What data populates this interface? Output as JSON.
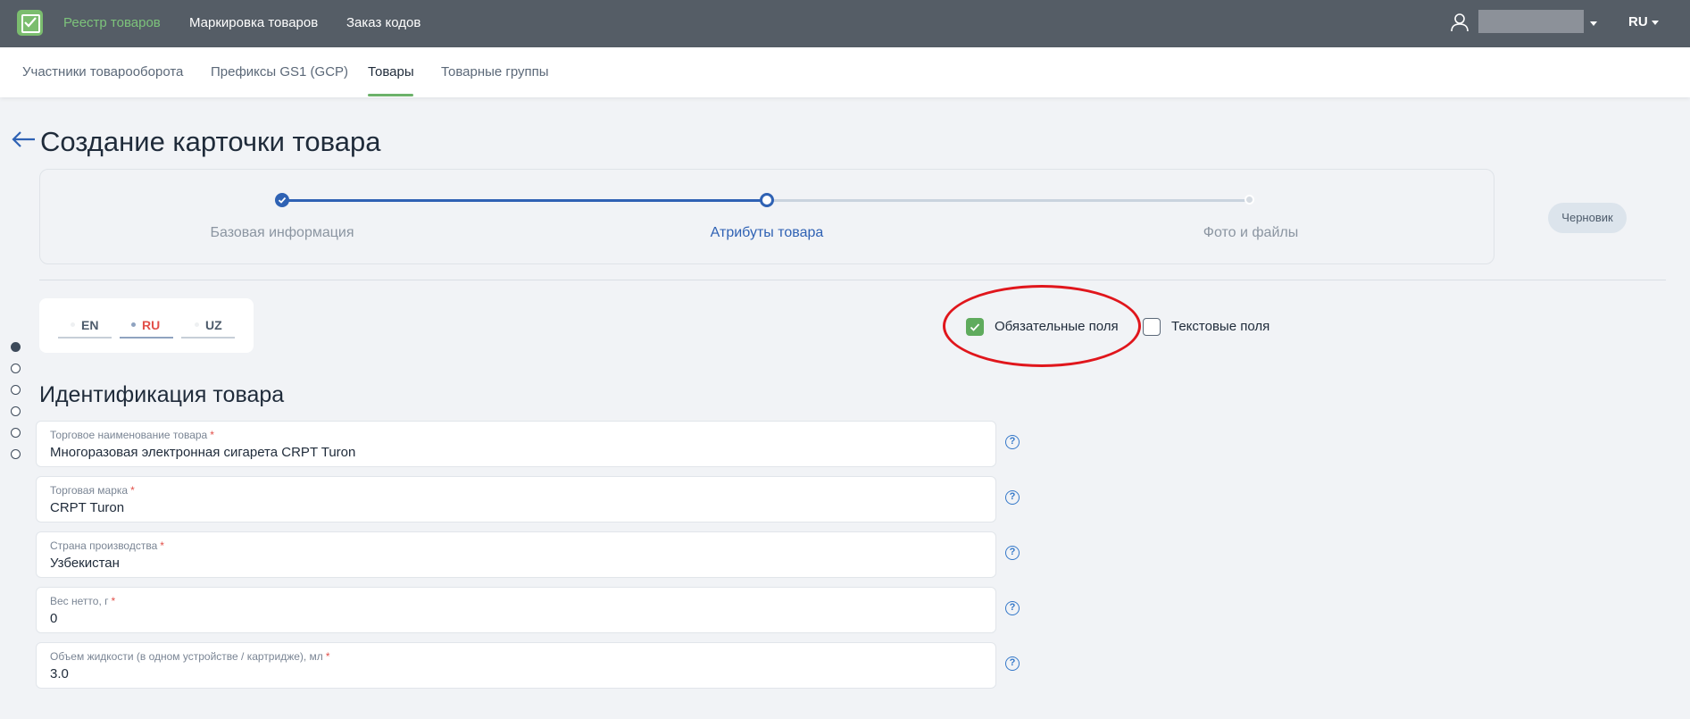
{
  "topbar": {
    "nav": [
      "Реестр товаров",
      "Маркировка товаров",
      "Заказ кодов"
    ],
    "lang": "RU"
  },
  "subnav": {
    "tabs": [
      "Участники товарооборота",
      "Префиксы GS1 (GCP)",
      "Товары",
      "Товарные группы"
    ],
    "active_tab": "Товары"
  },
  "page": {
    "title": "Создание карточки товара"
  },
  "stepper": {
    "steps": [
      "Базовая информация",
      "Атрибуты товара",
      "Фото и файлы"
    ],
    "status_badge": "Черновик"
  },
  "lang_tabs": [
    "EN",
    "RU",
    "UZ"
  ],
  "filters": {
    "required_label": "Обязательные поля",
    "required_checked": true,
    "text_label": "Текстовые поля",
    "text_checked": false
  },
  "section": {
    "title": "Идентификация товара"
  },
  "fields": [
    {
      "label": "Торговое наименование товара",
      "value": "Многоразовая электронная сигарета CRPT Turon"
    },
    {
      "label": "Торговая марка",
      "value": "CRPT Turon"
    },
    {
      "label": "Страна производства",
      "value": "Узбекистан"
    },
    {
      "label": "Вес нетто, г",
      "value": "0"
    },
    {
      "label": "Объем жидкости (в одном устройстве / картридже), мл",
      "value": "3.0"
    }
  ],
  "required_marker": "*",
  "help_glyph": "?",
  "colors": {
    "accent_green": "#7dc37b",
    "step_blue": "#2f62b4",
    "annotation_red": "#e0161c",
    "ru_red": "#e2504a"
  }
}
